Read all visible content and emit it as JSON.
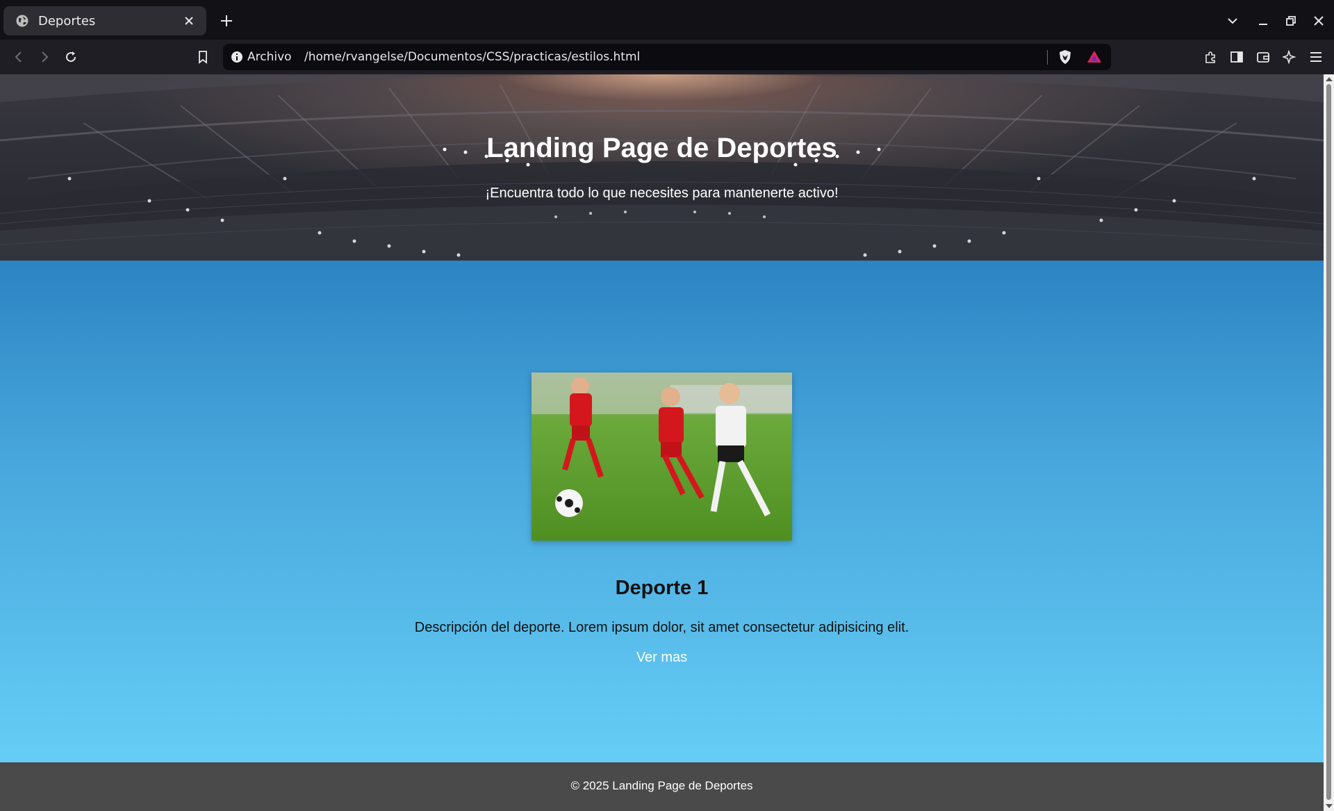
{
  "browser": {
    "tab": {
      "title": "Deportes",
      "favicon": "globe-icon"
    },
    "address": {
      "scheme_label": "Archivo",
      "url": "/home/rvangelse/Documentos/CSS/practicas/estilos.html"
    },
    "colors": {
      "chrome_bg": "#121116",
      "toolbar_bg": "#1f1e24",
      "urlbar_bg": "#0c0b0f"
    }
  },
  "page": {
    "header": {
      "title": "Landing Page de Deportes",
      "subtitle": "¡Encuentra todo lo que necesites para mantenerte activo!"
    },
    "card": {
      "image": "soccer-kids-photo",
      "title": "Deporte 1",
      "description": "Descripción del deporte. Lorem ipsum dolor, sit amet consectetur adipisicing elit.",
      "link_label": "Ver mas"
    },
    "footer": {
      "text": "© 2025 Landing Page de Deportes"
    },
    "colors": {
      "main_gradient_top": "#2c84c3",
      "main_gradient_bottom": "#65cdf6",
      "footer_bg": "#4a4a4a",
      "link": "#ffffff"
    }
  }
}
